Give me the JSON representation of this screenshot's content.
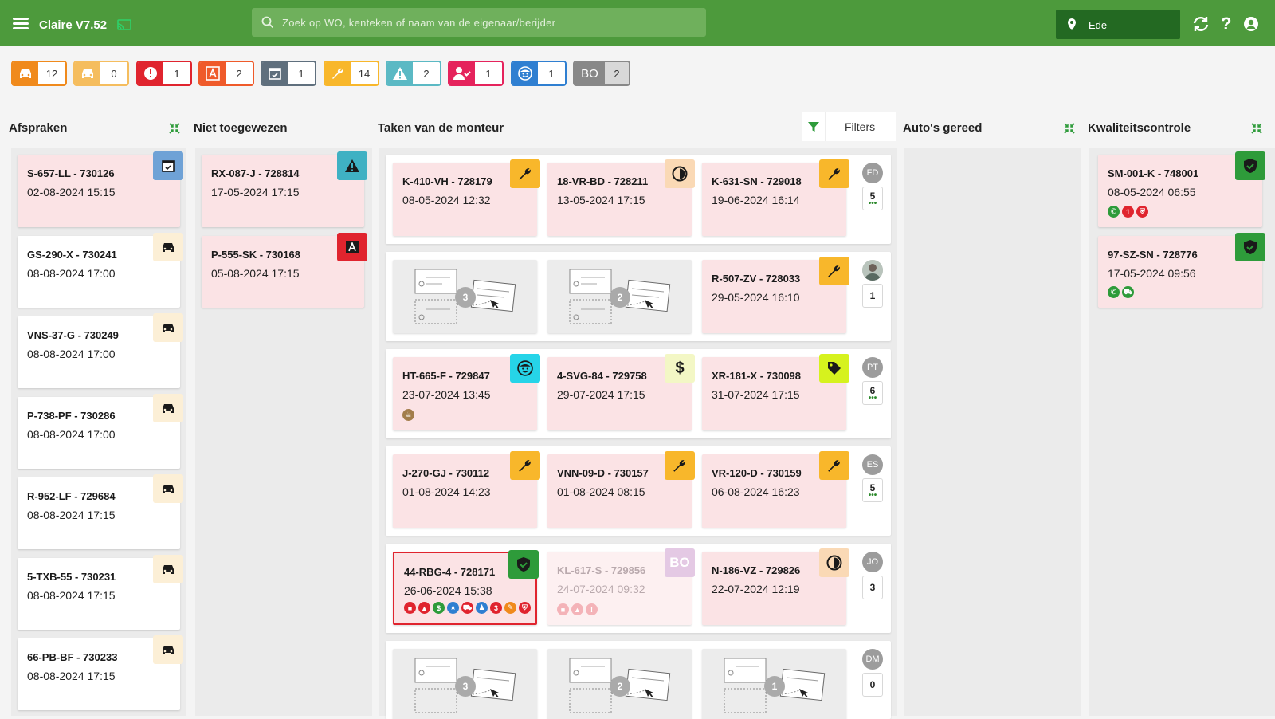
{
  "app": {
    "title": "Claire V7.52"
  },
  "search": {
    "placeholder": "Zoek op WO, kenteken of naam van de eigenaar/berijder"
  },
  "location": {
    "label": "Ede"
  },
  "colors": {
    "topbar": "#4d9a3c",
    "search_bg": "#6fb05c",
    "location_bg": "#236922",
    "card_pink": "#fbe3e5"
  },
  "badges": [
    {
      "icon": "car-icon",
      "count": "12",
      "color": "#f08a1c"
    },
    {
      "icon": "car-outline-icon",
      "count": "0",
      "color": "#f5bd5e"
    },
    {
      "icon": "alert-icon",
      "count": "1",
      "color": "#e0242e"
    },
    {
      "icon": "a-icon",
      "count": "2",
      "color": "#ef5a2a"
    },
    {
      "icon": "calendar-check-icon",
      "count": "1",
      "color": "#5f6f7d"
    },
    {
      "icon": "wrench-icon",
      "count": "14",
      "color": "#f8b72b"
    },
    {
      "icon": "warning-icon",
      "count": "2",
      "color": "#5bb9c4"
    },
    {
      "icon": "user-check-icon",
      "count": "1",
      "color": "#e5235c"
    },
    {
      "icon": "face-icon",
      "count": "1",
      "color": "#2f7fd1"
    },
    {
      "icon": "bo-label",
      "label": "BO",
      "count": "2",
      "color": "#888888"
    }
  ],
  "columns": {
    "afspraken": {
      "title": "Afspraken",
      "cards": [
        {
          "plate": "S-657-LL - 730126",
          "date": "02-08-2024 15:15",
          "icon": "calendar-check-icon"
        },
        {
          "plate": "GS-290-X - 730241",
          "date": "08-08-2024 17:00",
          "icon": "car-icon"
        },
        {
          "plate": "VNS-37-G - 730249",
          "date": "08-08-2024 17:00",
          "icon": "car-icon"
        },
        {
          "plate": "P-738-PF - 730286",
          "date": "08-08-2024 17:00",
          "icon": "car-icon"
        },
        {
          "plate": "R-952-LF - 729684",
          "date": "08-08-2024 17:15",
          "icon": "car-icon"
        },
        {
          "plate": "5-TXB-55 - 730231",
          "date": "08-08-2024 17:15",
          "icon": "car-icon"
        },
        {
          "plate": "66-PB-BF - 730233",
          "date": "08-08-2024 17:15",
          "icon": "car-icon"
        }
      ]
    },
    "niet_toegewezen": {
      "title": "Niet toegewezen",
      "cards": [
        {
          "plate": "RX-087-J - 728814",
          "date": "17-05-2024 17:15",
          "icon": "warning-icon"
        },
        {
          "plate": "P-555-SK - 730168",
          "date": "05-08-2024 17:15",
          "icon": "a-icon"
        }
      ]
    },
    "taken": {
      "title": "Taken van de monteur",
      "filters_label": "Filters",
      "rows": [
        {
          "avatar": "FD",
          "count": "5",
          "cards": [
            {
              "plate": "K-410-VH - 728179",
              "date": "08-05-2024 12:32",
              "icon": "wrench-icon"
            },
            {
              "plate": "18-VR-BD - 728211",
              "date": "13-05-2024 17:15",
              "icon": "clock-icon"
            },
            {
              "plate": "K-631-SN - 729018",
              "date": "19-06-2024 16:14",
              "icon": "wrench-icon"
            }
          ]
        },
        {
          "avatar": "",
          "count": "1",
          "cards": [
            {
              "placeholder": "3"
            },
            {
              "placeholder": "2"
            },
            {
              "plate": "R-507-ZV - 728033",
              "date": "29-05-2024 16:10",
              "icon": "wrench-icon"
            }
          ]
        },
        {
          "avatar": "PT",
          "count": "6",
          "cards": [
            {
              "plate": "HT-665-F - 729847",
              "date": "23-07-2024 13:45",
              "icon": "face-icon"
            },
            {
              "plate": "4-SVG-84 - 729758",
              "date": "29-07-2024 17:15",
              "icon": "dollar-icon"
            },
            {
              "plate": "XR-181-X - 730098",
              "date": "31-07-2024 17:15",
              "icon": "tag-icon"
            }
          ]
        },
        {
          "avatar": "ES",
          "count": "5",
          "cards": [
            {
              "plate": "J-270-GJ - 730112",
              "date": "01-08-2024 14:23",
              "icon": "wrench-icon"
            },
            {
              "plate": "VNN-09-D - 730157",
              "date": "01-08-2024 08:15",
              "icon": "wrench-icon"
            },
            {
              "plate": "VR-120-D - 730159",
              "date": "06-08-2024 16:23",
              "icon": "wrench-icon"
            }
          ]
        },
        {
          "avatar": "JO",
          "count": "3",
          "cards": [
            {
              "plate": "44-RBG-4 - 728171",
              "date": "26-06-2024 15:38",
              "icon": "shield-check-icon"
            },
            {
              "plate": "KL-617-S - 729856",
              "date": "24-07-2024 09:32",
              "icon": "bo-label",
              "label": "BO"
            },
            {
              "plate": "N-186-VZ - 729826",
              "date": "22-07-2024 12:19",
              "icon": "clock-icon"
            }
          ]
        },
        {
          "avatar": "DM",
          "count": "0",
          "cards": [
            {
              "placeholder": "3"
            },
            {
              "placeholder": "2"
            },
            {
              "placeholder": "1"
            }
          ]
        }
      ]
    },
    "gereed": {
      "title": "Auto's gereed"
    },
    "kwaliteit": {
      "title": "Kwaliteitscontrole",
      "cards": [
        {
          "plate": "SM-001-K - 748001",
          "date": "08-05-2024 06:55",
          "icon": "shield-check-icon",
          "dot_badge": "1"
        },
        {
          "plate": "97-SZ-SN - 728776",
          "date": "17-05-2024 09:56",
          "icon": "shield-check-icon"
        }
      ]
    }
  },
  "dot_badges": {
    "row5_a": "3"
  }
}
